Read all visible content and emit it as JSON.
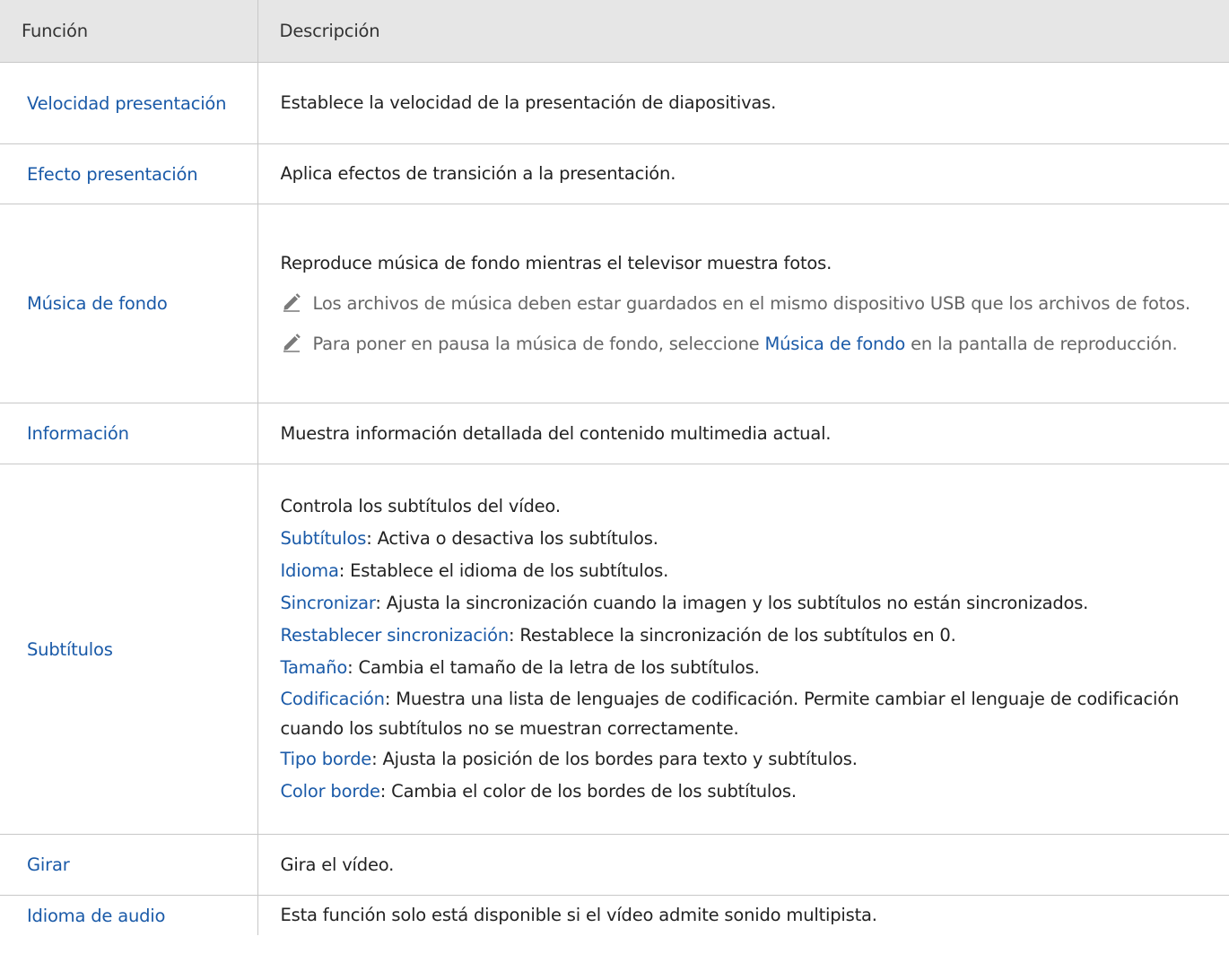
{
  "header": {
    "col1": "Función",
    "col2": "Descripción"
  },
  "rows": {
    "velocidad": {
      "name": "Velocidad presentación",
      "desc": "Establece la velocidad de la presentación de diapositivas."
    },
    "efecto": {
      "name": "Efecto presentación",
      "desc": "Aplica efectos de transición a la presentación."
    },
    "musica": {
      "name": "Música de fondo",
      "desc": "Reproduce música de fondo mientras el televisor muestra fotos.",
      "note1": "Los archivos de música deben estar guardados en el mismo dispositivo USB que los archivos de fotos.",
      "note2_before": "Para poner en pausa la música de fondo, seleccione ",
      "note2_link": "Música de fondo",
      "note2_after": " en la pantalla de reproducción."
    },
    "informacion": {
      "name": "Información",
      "desc": "Muestra información detallada del contenido multimedia actual."
    },
    "subtitulos": {
      "name": "Subtítulos",
      "desc": "Controla los subtítulos del vídeo.",
      "items": [
        {
          "key": "Subtítulos",
          "text": ": Activa o desactiva los subtítulos."
        },
        {
          "key": "Idioma",
          "text": ": Establece el idioma de los subtítulos."
        },
        {
          "key": "Sincronizar",
          "text": ": Ajusta la sincronización cuando la imagen y los subtítulos no están sincronizados."
        },
        {
          "key": "Restablecer sincronización",
          "text": ": Restablece la sincronización de los subtítulos en 0."
        },
        {
          "key": "Tamaño",
          "text": ": Cambia el tamaño de la letra de los subtítulos."
        },
        {
          "key": "Codificación",
          "text": ": Muestra una lista de lenguajes de codificación. Permite cambiar el lenguaje de codificación cuando los subtítulos no se muestran correctamente."
        },
        {
          "key": "Tipo borde",
          "text": ": Ajusta la posición de los bordes para texto y subtítulos."
        },
        {
          "key": "Color borde",
          "text": ": Cambia el color de los bordes de los subtítulos."
        }
      ]
    },
    "girar": {
      "name": "Girar",
      "desc": "Gira el vídeo."
    },
    "audio": {
      "name": "Idioma de audio",
      "desc": "Esta función solo está disponible si el vídeo admite sonido multipista."
    }
  },
  "colors": {
    "link": "#1a5aa8",
    "header_bg": "#e6e6e6",
    "note_text": "#666666",
    "border": "#c8c8c8"
  },
  "icons": {
    "note": "pencil-note-icon"
  }
}
